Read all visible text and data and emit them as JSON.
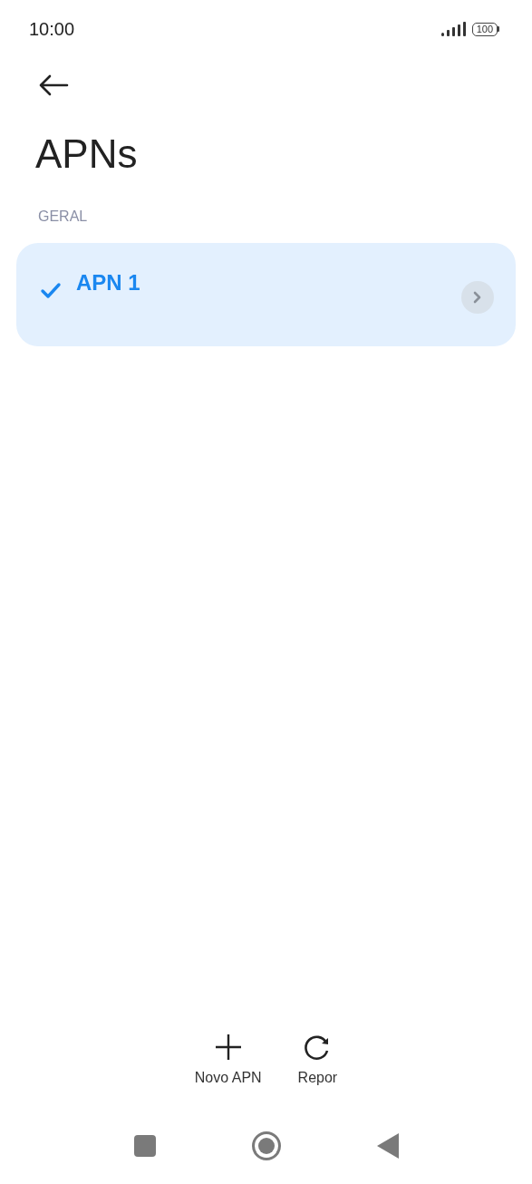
{
  "status_bar": {
    "time": "10:00",
    "battery": "100"
  },
  "title": "APNs",
  "section": {
    "header": "GERAL",
    "items": [
      {
        "name": "APN 1",
        "selected": true
      }
    ]
  },
  "actions": [
    {
      "kind": "add",
      "label": "Novo APN"
    },
    {
      "kind": "reset",
      "label": "Repor"
    }
  ]
}
